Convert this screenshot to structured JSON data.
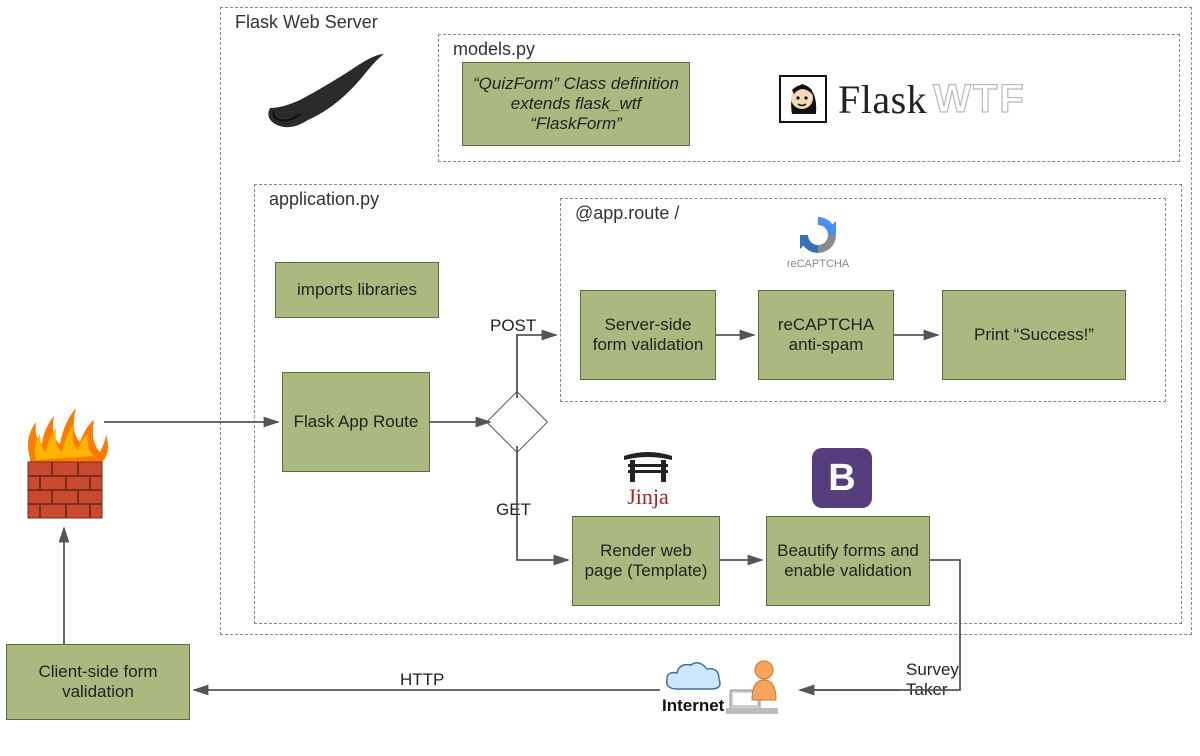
{
  "containers": {
    "flask_web_server": "Flask Web Server",
    "models_py": "models.py",
    "application_py": "application.py",
    "app_route": "@app.route /"
  },
  "nodes": {
    "quizform": "“QuizForm” Class definition extends flask_wtf “FlaskForm”",
    "imports": "imports libraries",
    "flask_app_route": "Flask App Route",
    "server_side_validation": "Server-side form validation",
    "recaptcha_antispam": "reCAPTCHA anti-spam",
    "print_success": "Print “Success!”",
    "render_template": "Render web page (Template)",
    "beautify": "Beautify forms and enable validation",
    "client_side_validation": "Client-side form validation"
  },
  "labels": {
    "post": "POST",
    "get": "GET",
    "http": "HTTP",
    "survey_taker": "Survey Taker",
    "internet": "Internet"
  },
  "logos": {
    "flaskwtf_a": "Flask",
    "flaskwtf_b": "WTF",
    "recaptcha_caption": "reCAPTCHA",
    "jinja": "Jinja",
    "bootstrap": "B"
  },
  "icons": {
    "horn": "horn-icon",
    "firewall": "firewall-icon",
    "flaskwtf_man": "flaskwtf-man-icon",
    "recaptcha_spinner": "recaptcha-icon",
    "jinja_gate": "jinja-gate-icon",
    "bootstrap": "bootstrap-icon",
    "cloud": "cloud-icon",
    "user": "user-at-desk-icon"
  }
}
